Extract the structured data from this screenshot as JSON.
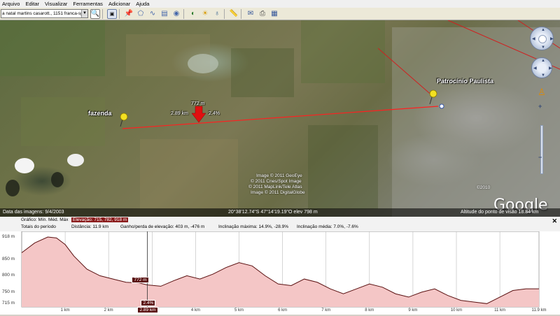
{
  "menu": [
    "Arquivo",
    "Editar",
    "Visualizar",
    "Ferramentas",
    "Adicionar",
    "Ajuda"
  ],
  "search": {
    "value": "a natal martins casarott., 1151 franca-sp"
  },
  "map": {
    "labels": {
      "fazenda": "fazenda",
      "city": "Patrocínio Paulista",
      "distance_left": "2.89 km",
      "grade": "2.4%",
      "elevation_marker": "772 m"
    },
    "credits": [
      "Image © 2011 GeoEye",
      "© 2011 Cnes/Spot Image",
      "© 2011 MapLink/Tele Atlas",
      "Image © 2011 DigitalGlobe"
    ],
    "copyright": "©2010",
    "logo": "Google",
    "status": {
      "date": "Data das imagens: 9/4/2003",
      "coords": "20°38'12.74\"S   47°14'19.19\"O  elev  798 m",
      "altitude": "Altitude do ponto de visão   18.84 km"
    }
  },
  "profile": {
    "graph_label": "Gráfico:  Mín.  Méd.  Máx",
    "elev_label": "Elevação: 715, 782, 918 m",
    "totals_label": "Totais do período",
    "distance": "Distância: 11.9 km",
    "gainloss": "Ganho/perda de elevação: 403 m, -476 m",
    "max_slope": "Inclinação máxima: 14.9%, -28.9%",
    "avg_slope": "Inclinação média: 7.0%, -7.6%",
    "close": "✕"
  },
  "chart_data": {
    "type": "area",
    "xlabel": "",
    "ylabel": "",
    "x_unit": "km",
    "y_unit": "m",
    "xlim": [
      0,
      11.9
    ],
    "ylim": [
      705,
      935
    ],
    "y_ticks": [
      "918 m",
      "850 m",
      "800 m",
      "750 m",
      "715 m"
    ],
    "y_tick_values": [
      918,
      850,
      800,
      750,
      715
    ],
    "x_ticks": [
      "1 km",
      "2 km",
      "3 km",
      "4 km",
      "5 km",
      "6 km",
      "7 km",
      "8 km",
      "9 km",
      "10 km",
      "11 km",
      "11.9 km"
    ],
    "x_tick_values": [
      1,
      2,
      3,
      4,
      5,
      6,
      7,
      8,
      9,
      10,
      11,
      11.9
    ],
    "x": [
      0,
      0.3,
      0.6,
      0.8,
      1.0,
      1.2,
      1.5,
      1.8,
      2.1,
      2.4,
      2.7,
      2.89,
      3.2,
      3.5,
      3.8,
      4.1,
      4.4,
      4.7,
      5.0,
      5.3,
      5.6,
      5.9,
      6.2,
      6.5,
      6.8,
      7.1,
      7.4,
      7.7,
      8.0,
      8.3,
      8.6,
      8.9,
      9.2,
      9.5,
      9.8,
      10.1,
      10.4,
      10.7,
      11.0,
      11.3,
      11.6,
      11.9
    ],
    "values": [
      870,
      900,
      918,
      915,
      895,
      860,
      820,
      800,
      790,
      780,
      778,
      772,
      768,
      785,
      800,
      790,
      805,
      825,
      840,
      830,
      800,
      775,
      770,
      790,
      780,
      760,
      745,
      760,
      775,
      765,
      745,
      735,
      750,
      760,
      740,
      725,
      720,
      715,
      735,
      755,
      760,
      760
    ],
    "cursor": {
      "x": 2.89,
      "elevation": "772 m",
      "distance": "2.89 km",
      "grade": "2.4%"
    }
  },
  "colors": {
    "profile_line": "#5a1010",
    "profile_fill": "#f4c6c6",
    "path": "#ff2020"
  }
}
